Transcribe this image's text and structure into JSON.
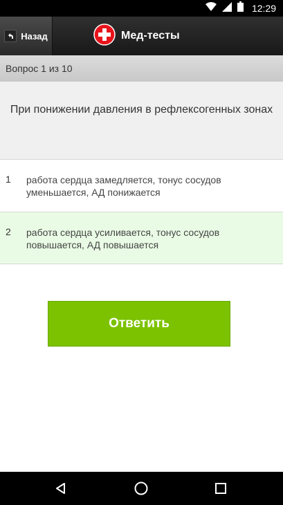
{
  "statusbar": {
    "time": "12:29",
    "icons": [
      "wifi-icon",
      "cellular-signal-icon",
      "battery-icon"
    ]
  },
  "appbar": {
    "back_label": "Назад",
    "title": "Мед-тесты",
    "logo": "red-cross-icon"
  },
  "progress": {
    "label": "Вопрос 1 из 10"
  },
  "question": {
    "text": "При понижении давления в рефлексогенных зонах"
  },
  "answers": [
    {
      "num": "1",
      "text": "работа сердца замедляется, тонус сосудов уменьшается, АД понижается",
      "selected": false
    },
    {
      "num": "2",
      "text": "работа сердца усиливается, тонус сосудов повышается, АД повышается",
      "selected": true
    }
  ],
  "submit": {
    "label": "Ответить"
  },
  "navbar": {
    "icons": [
      "back-triangle-icon",
      "home-circle-icon",
      "recents-square-icon"
    ]
  },
  "colors": {
    "accent": "#7cc200",
    "selected_bg": "#e9fbe4",
    "logo_red": "#e8141b"
  }
}
